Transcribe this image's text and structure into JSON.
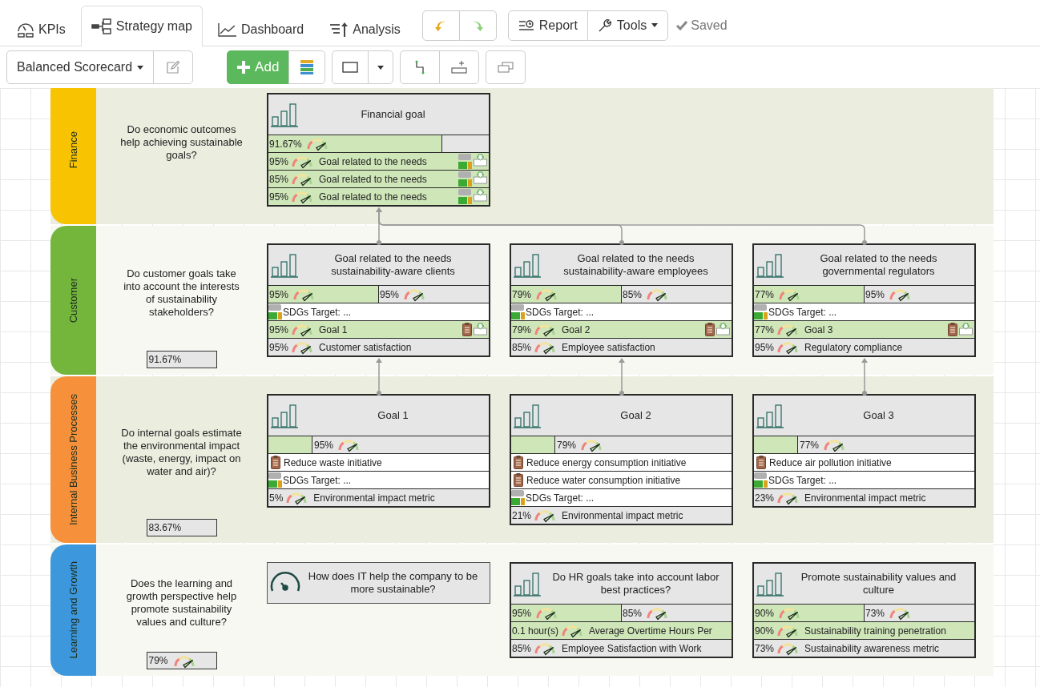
{
  "tabs": [
    {
      "label": "KPIs",
      "selected": false
    },
    {
      "label": "Strategy map",
      "selected": true
    },
    {
      "label": "Dashboard",
      "selected": false
    },
    {
      "label": "Analysis",
      "selected": false
    }
  ],
  "toolbar": {
    "report": "Report",
    "tools": "Tools",
    "status": "Saved",
    "map_name": "Balanced Scorecard",
    "add": "Add"
  },
  "lanes": [
    {
      "label": "Finance",
      "color": "#f8c300",
      "question": "Do economic outcomes help achieving sustainable goals?",
      "cards": [
        {
          "kind": "goal",
          "connected": false,
          "title": "Financial goal",
          "rows": [
            {
              "kind": "bar",
              "level": 0.79,
              "value": "91.67%"
            },
            {
              "kind": "metric",
              "highlighted": true,
              "value": "95%",
              "name": "Goal related to the needs",
              "badges": [
                {
                  "kind": "sdg"
                },
                {
                  "kind": "export"
                }
              ]
            },
            {
              "kind": "metric",
              "highlighted": true,
              "value": "85%",
              "name": "Goal related to the needs",
              "badges": [
                {
                  "kind": "sdg"
                },
                {
                  "kind": "export"
                }
              ]
            },
            {
              "kind": "metric",
              "highlighted": true,
              "value": "95%",
              "name": "Goal related to the needs",
              "badges": [
                {
                  "kind": "sdg"
                },
                {
                  "kind": "export"
                }
              ]
            }
          ]
        }
      ]
    },
    {
      "label": "Customer",
      "color": "#74b63c",
      "question": "Do customer goals take into account the interests of sustainability stakeholders?",
      "score": {
        "value": "91.67%"
      },
      "cards": [
        {
          "kind": "goal",
          "connected": true,
          "title": "Goal related to the needs sustainability-aware clients",
          "rows": [
            {
              "kind": "split",
              "cells": [
                {
                  "highlighted": true,
                  "value": "95%"
                },
                {
                  "highlighted": false,
                  "value": "95%"
                }
              ]
            },
            {
              "kind": "sdg",
              "label": "SDGs Target: ..."
            },
            {
              "kind": "metric",
              "highlighted": true,
              "value": "95%",
              "name": "Goal 1",
              "badges": [
                {
                  "kind": "clipboard"
                },
                {
                  "kind": "export"
                }
              ]
            },
            {
              "kind": "metric",
              "highlighted": false,
              "value": "95%",
              "name": "Customer satisfaction"
            }
          ]
        },
        {
          "kind": "goal",
          "connected": true,
          "title": "Goal related to the needs sustainability-aware employees",
          "rows": [
            {
              "kind": "split",
              "cells": [
                {
                  "highlighted": true,
                  "value": "79%"
                },
                {
                  "highlighted": false,
                  "value": "85%"
                }
              ]
            },
            {
              "kind": "sdg",
              "label": "SDGs Target: ..."
            },
            {
              "kind": "metric",
              "highlighted": true,
              "value": "79%",
              "name": "Goal 2",
              "badges": [
                {
                  "kind": "clipboard"
                },
                {
                  "kind": "export"
                }
              ]
            },
            {
              "kind": "metric",
              "highlighted": false,
              "value": "85%",
              "name": "Employee satisfaction"
            }
          ]
        },
        {
          "kind": "goal",
          "connected": true,
          "title": "Goal related to the needs governmental regulators",
          "rows": [
            {
              "kind": "split",
              "cells": [
                {
                  "highlighted": true,
                  "value": "77%"
                },
                {
                  "highlighted": false,
                  "value": "95%"
                }
              ]
            },
            {
              "kind": "sdg",
              "label": "SDGs Target: ..."
            },
            {
              "kind": "metric",
              "highlighted": true,
              "value": "77%",
              "name": "Goal 3",
              "badges": [
                {
                  "kind": "clipboard"
                },
                {
                  "kind": "export"
                }
              ]
            },
            {
              "kind": "metric",
              "highlighted": false,
              "value": "95%",
              "name": "Regulatory compliance"
            }
          ]
        }
      ]
    },
    {
      "label": "Internal Business Processes",
      "color": "#f7903a",
      "question": "Do internal goals estimate the environmental impact (waste, energy, impact on water and air)?",
      "score": {
        "value": "83.67%"
      },
      "cards": [
        {
          "kind": "goal",
          "connected": true,
          "title": "Goal 1",
          "rows": [
            {
              "kind": "bar",
              "level": 0.2,
              "value": "95%"
            },
            {
              "kind": "initiative",
              "label": "Reduce waste initiative"
            },
            {
              "kind": "sdg",
              "label": "SDGs Target: ..."
            },
            {
              "kind": "metric",
              "highlighted": false,
              "value": "5%",
              "name": "Environmental impact metric"
            }
          ]
        },
        {
          "kind": "goal",
          "connected": true,
          "title": "Goal 2",
          "rows": [
            {
              "kind": "bar",
              "level": 0.2,
              "value": "79%"
            },
            {
              "kind": "initiative",
              "label": "Reduce energy consumption initiative"
            },
            {
              "kind": "initiative",
              "label": "Reduce water consumption initiative"
            },
            {
              "kind": "sdg",
              "label": "SDGs Target: ..."
            },
            {
              "kind": "metric",
              "highlighted": false,
              "value": "21%",
              "name": "Environmental impact metric"
            }
          ]
        },
        {
          "kind": "goal",
          "connected": true,
          "title": "Goal 3",
          "rows": [
            {
              "kind": "bar",
              "level": 0.2,
              "value": "77%"
            },
            {
              "kind": "initiative",
              "label": "Reduce air pollution initiative"
            },
            {
              "kind": "sdg",
              "label": "SDGs Target: ..."
            },
            {
              "kind": "metric",
              "highlighted": false,
              "value": "23%",
              "name": "Environmental impact metric"
            }
          ]
        }
      ]
    },
    {
      "label": "Learning and Growth",
      "color": "#3d97dc",
      "question": "Does the learning and growth perspective help promote sustainability values and culture?",
      "score": {
        "value": "79%",
        "kind": "gauge"
      },
      "cards": [
        {
          "kind": "question",
          "connected": false,
          "title": "How does IT help the company to be more sustainable?"
        },
        {
          "kind": "goal",
          "connected": false,
          "title": "Do HR goals take into account labor best practices?",
          "rows": [
            {
              "kind": "split",
              "cells": [
                {
                  "highlighted": true,
                  "value": "95%"
                },
                {
                  "highlighted": false,
                  "value": "85%"
                }
              ]
            },
            {
              "kind": "metric",
              "highlighted": true,
              "value": "0.1 hour(s)",
              "name": "Average Overtime Hours Per"
            },
            {
              "kind": "metric",
              "highlighted": false,
              "value": "85%",
              "name": "Employee Satisfaction with Work"
            }
          ]
        },
        {
          "kind": "goal",
          "connected": false,
          "title": "Promote sustainability values and culture",
          "rows": [
            {
              "kind": "split",
              "cells": [
                {
                  "highlighted": true,
                  "value": "90%"
                },
                {
                  "highlighted": false,
                  "value": "73%"
                }
              ]
            },
            {
              "kind": "metric",
              "highlighted": true,
              "value": "90%",
              "name": "Sustainability training penetration"
            },
            {
              "kind": "metric",
              "highlighted": false,
              "value": "73%",
              "name": "Sustainability awareness metric"
            }
          ]
        }
      ]
    }
  ]
}
